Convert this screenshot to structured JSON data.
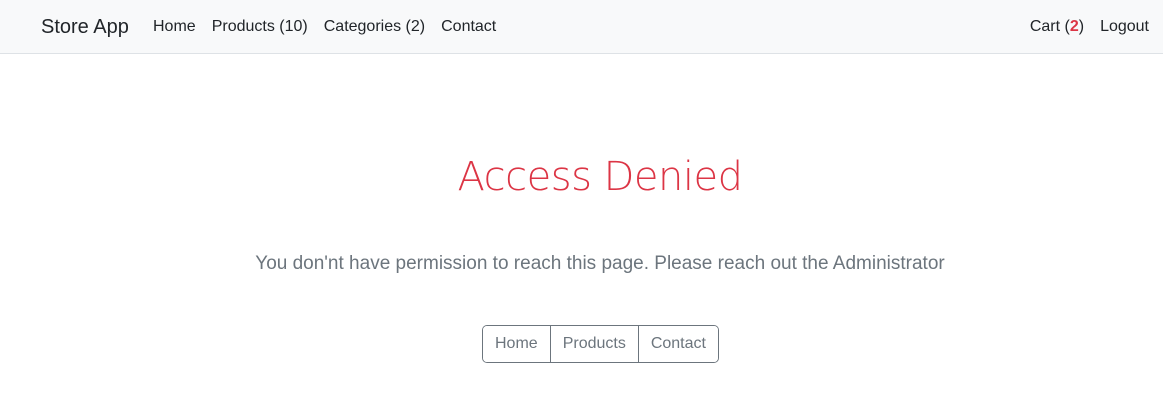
{
  "navbar": {
    "brand": "Store App",
    "links": [
      {
        "label": "Home"
      },
      {
        "label": "Products (10)"
      },
      {
        "label": "Categories (2)"
      },
      {
        "label": "Contact"
      }
    ],
    "cart": {
      "label_prefix": "Cart (",
      "count": "2",
      "label_suffix": ")"
    },
    "logout": "Logout"
  },
  "main": {
    "title": "Access Denied",
    "message": "You don'nt have permission to reach this page. Please reach out the Administrator",
    "buttons": [
      {
        "label": "Home"
      },
      {
        "label": "Products"
      },
      {
        "label": "Contact"
      }
    ]
  },
  "colors": {
    "navbar_bg": "#f8f9fa",
    "danger": "#dc3545",
    "muted": "#6c757d"
  }
}
